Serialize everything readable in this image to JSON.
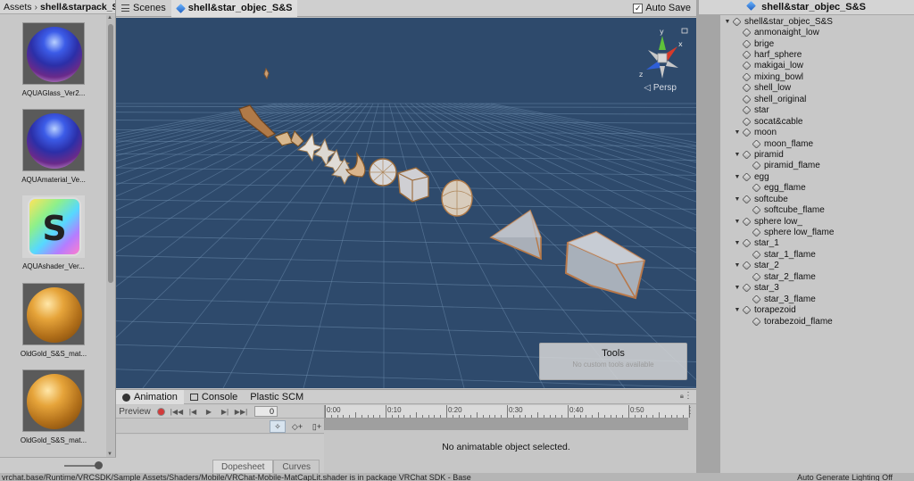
{
  "assets": {
    "tab_label": "Assets",
    "separator": "›",
    "folder": "shell&starpack_S",
    "items": [
      {
        "label": "AQUAGlass_Ver2...",
        "thumb": "aqua-sphere"
      },
      {
        "label": "AQUAmaterial_Ve...",
        "thumb": "aqua-sphere"
      },
      {
        "label": "AQUAshader_Ver...",
        "thumb": "shader-file",
        "glyph": "S"
      },
      {
        "label": "OldGold_S&S_mat...",
        "thumb": "gold-sphere"
      },
      {
        "label": "OldGold_S&S_mat...",
        "thumb": "gold-sphere"
      }
    ]
  },
  "scene": {
    "tabs": [
      {
        "label": "Scenes",
        "icon": "scenes-icon"
      },
      {
        "label": "shell&star_objec_S&S",
        "icon": "unity-cube-icon"
      }
    ],
    "autosave_label": "Auto Save",
    "autosave_checked": true,
    "persp_label": "Persp",
    "gizmo_axes": {
      "y": "y",
      "x": "x",
      "z": "z"
    },
    "tools_title": "Tools",
    "tools_subtitle": "No custom tools available",
    "colors": {
      "background": "#2e4a6c",
      "grid": "#6f8fb0",
      "gizmo_y": "#5fc23a",
      "gizmo_x": "#d83a2a",
      "gizmo_z": "#2f5fd8"
    }
  },
  "animation": {
    "tabs": [
      {
        "label": "Animation",
        "icon": "animation-icon"
      },
      {
        "label": "Console",
        "icon": "console-icon"
      },
      {
        "label": "Plastic SCM",
        "icon": ""
      }
    ],
    "preview_label": "Preview",
    "frame_value": "0",
    "timeline_labels": [
      "0:00",
      "0:10",
      "0:20",
      "0:30",
      "0:40",
      "0:50"
    ],
    "empty_message": "No animatable object selected.",
    "bottom_tabs": [
      "Dopesheet",
      "Curves"
    ]
  },
  "hierarchy": {
    "title": "shell&star_objec_S&S",
    "items": [
      {
        "label": "shell&star_objec_S&S",
        "depth": 0,
        "expanded": true
      },
      {
        "label": "anmonaight_low",
        "depth": 1
      },
      {
        "label": "brige",
        "depth": 1
      },
      {
        "label": "harf_sphere",
        "depth": 1
      },
      {
        "label": "makigai_low",
        "depth": 1
      },
      {
        "label": "mixing_bowl",
        "depth": 1
      },
      {
        "label": "shell_low",
        "depth": 1
      },
      {
        "label": "shell_original",
        "depth": 1
      },
      {
        "label": "star",
        "depth": 1
      },
      {
        "label": "socat&cable",
        "depth": 1
      },
      {
        "label": "moon",
        "depth": 1,
        "expanded": true
      },
      {
        "label": "moon_flame",
        "depth": 2
      },
      {
        "label": "piramid",
        "depth": 1,
        "expanded": true
      },
      {
        "label": "piramid_flame",
        "depth": 2
      },
      {
        "label": "egg",
        "depth": 1,
        "expanded": true
      },
      {
        "label": "egg_flame",
        "depth": 2
      },
      {
        "label": "softcube",
        "depth": 1,
        "expanded": true
      },
      {
        "label": "softcube_flame",
        "depth": 2
      },
      {
        "label": "sphere low_",
        "depth": 1,
        "expanded": true
      },
      {
        "label": "sphere low_flame",
        "depth": 2
      },
      {
        "label": "star_1",
        "depth": 1,
        "expanded": true
      },
      {
        "label": "star_1_flame",
        "depth": 2
      },
      {
        "label": "star_2",
        "depth": 1,
        "expanded": true
      },
      {
        "label": "star_2_flame",
        "depth": 2
      },
      {
        "label": "star_3",
        "depth": 1,
        "expanded": true
      },
      {
        "label": "star_3_flame",
        "depth": 2
      },
      {
        "label": "torapezoid",
        "depth": 1,
        "expanded": true
      },
      {
        "label": "torabezoid_flame",
        "depth": 2
      }
    ]
  },
  "status": {
    "message": "vrchat.base/Runtime/VRCSDK/Sample Assets/Shaders/Mobile/VRChat-Mobile-MatCapLit.shader is in package VRChat SDK - Base",
    "right": "Auto Generate Lighting Off"
  }
}
